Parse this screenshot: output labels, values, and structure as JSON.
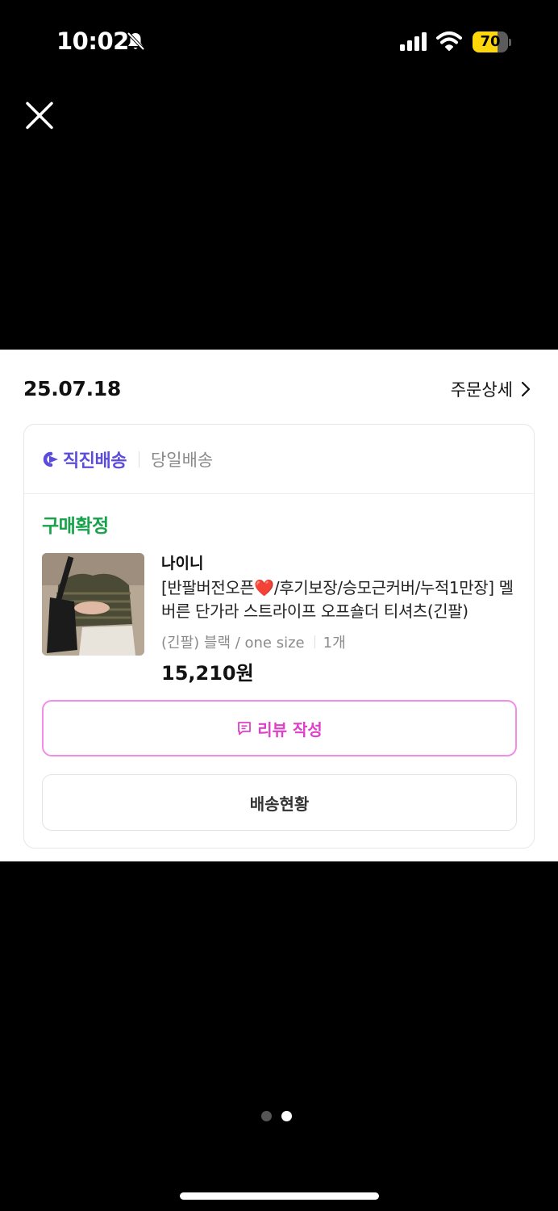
{
  "status_bar": {
    "time": "10:02",
    "battery": "70",
    "battery_level": 0.7,
    "battery_color": "#ffd60a",
    "icons": [
      "bell-slash-icon",
      "cellular-signal-icon",
      "wifi-icon",
      "battery-icon"
    ]
  },
  "top": {
    "close_icon": "close-icon"
  },
  "order": {
    "date": "25.07.18",
    "detail_label": "주문상세",
    "detail_icon": "chevron-right-icon"
  },
  "delivery": {
    "direct_label": "직진배송",
    "direct_icon": "direct-delivery-icon",
    "sameday_label": "당일배송",
    "accent_color": "#5b4cde"
  },
  "item": {
    "status": "구매확정",
    "status_color": "#16a34a",
    "brand": "나이니",
    "title": "[반팔버전오픈❤️/후기보장/승모근커버/누적1만장] 멜버른 단가라 스트라이프 오프숄더 티셔츠(긴팔)",
    "option": "(긴팔) 블랙 / one size",
    "quantity": "1개",
    "price": "15,210원"
  },
  "actions": {
    "review_label": "리뷰 작성",
    "review_icon": "chat-bubble-icon",
    "review_color": "#e040c9",
    "shipping_label": "배송현황"
  },
  "pager": {
    "count": 2,
    "active_index": 1
  }
}
